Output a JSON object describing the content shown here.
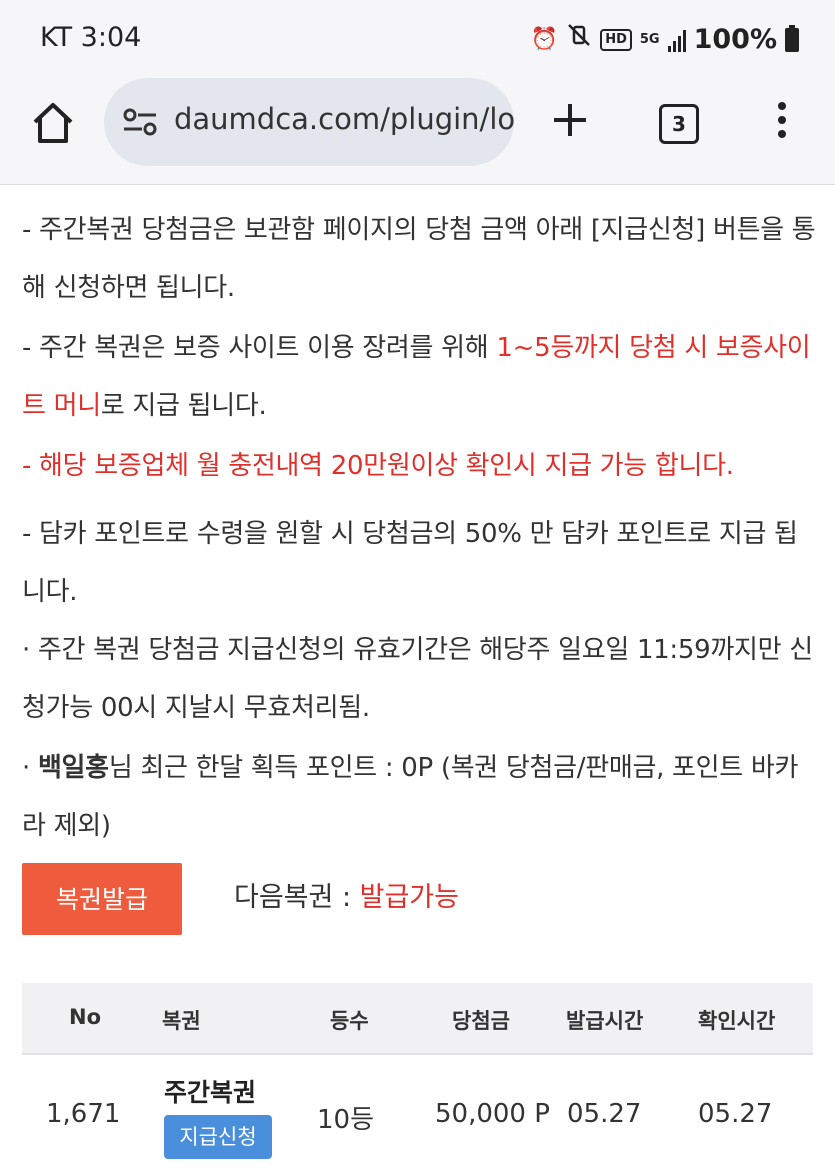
{
  "status_bar": {
    "carrier_time": "KT 3:04",
    "battery": "100%",
    "hd_label": "HD",
    "net_label": "5G"
  },
  "browser": {
    "url": "daumdca.com/plugin/lo",
    "tab_count": "3"
  },
  "paragraphs": {
    "p1": "- 주간복권 당첨금은 보관함 페이지의 당첨 금액 아래 [지급신청] 버튼을 통해 신청하면 됩니다.",
    "p2_a": "- 주간 복권은 보증 사이트 이용 장려를 위해 ",
    "p2_red": "1~5등까지 당첨 시 보증사이트 머니",
    "p2_b": "로 지급 됩니다.",
    "p3_red": "- 해당 보증업체 월 충전내역 20만원이상 확인시 지급 가능 합니다.",
    "p4": "- 담카 포인트로 수령을 원할 시 당첨금의 50% 만 담카 포인트로 지급 됩니다.",
    "p5": "· 주간 복권 당첨금 지급신청의 유효기간은 해당주 일요일 11:59까지만 신청가능 00시 지날시 무효처리됨.",
    "p6_prefix": "· ",
    "p6_name": "백일홍",
    "p6_rest": "님 최근 한달 획득 포인트 : 0P (복권 당첨금/판매금, 포인트 바카라 제외)"
  },
  "actions": {
    "issue_button": "복권발급",
    "next_label": "다음복권 : ",
    "next_value": "발급가능"
  },
  "table": {
    "headers": {
      "no": "No",
      "ticket": "복권",
      "rank": "등수",
      "prize": "당첨금",
      "issued": "발급시간",
      "checked": "확인시간"
    },
    "rows": [
      {
        "no": "1,671",
        "ticket": "주간복권",
        "claim": "지급신청",
        "rank": "10등",
        "prize": "50,000 P",
        "issued": "05.27",
        "checked": "05.27"
      }
    ]
  }
}
